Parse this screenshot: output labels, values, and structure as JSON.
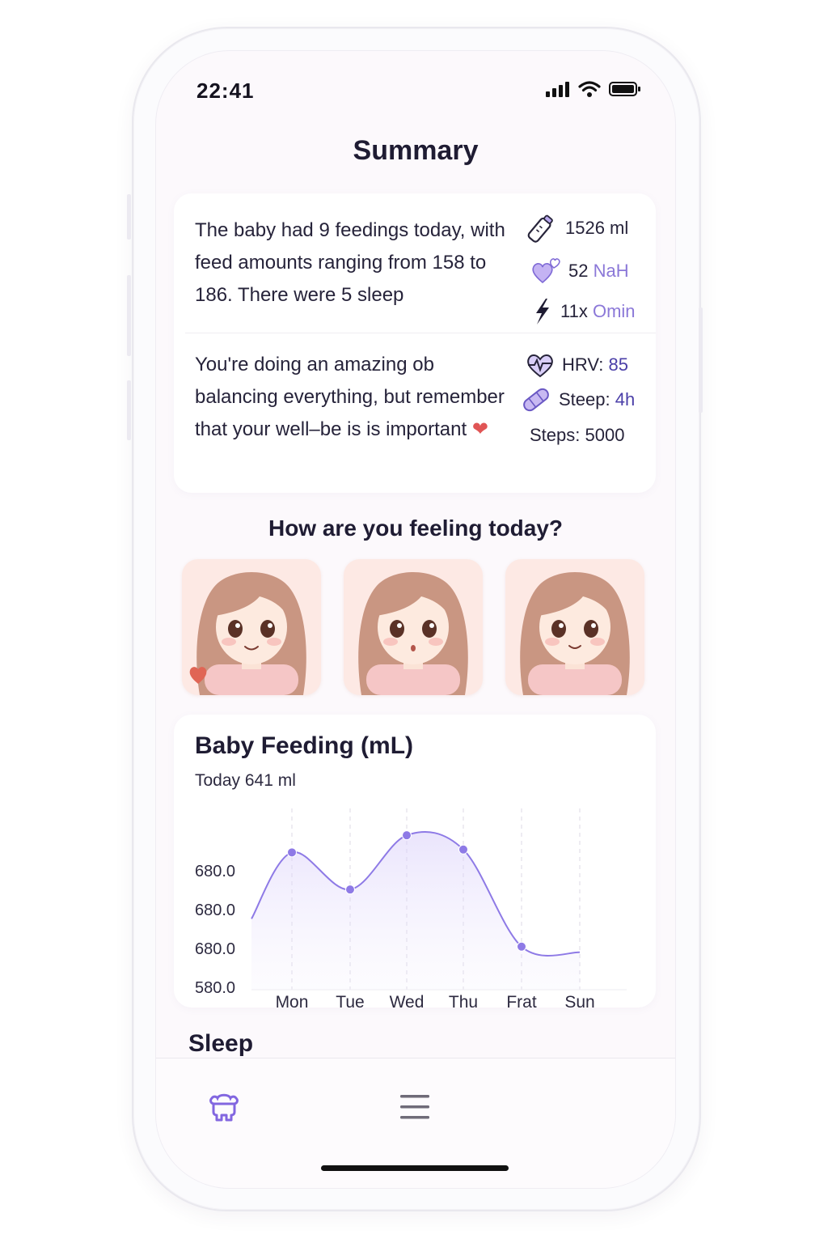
{
  "status_bar": {
    "time": "22:41"
  },
  "page": {
    "title": "Summary"
  },
  "summary": {
    "text": "The baby had 9 feedings today, with feed amounts ranging from 158 to 186. There were 5 sleep",
    "stats": [
      {
        "icon": "baby-bottle-icon",
        "value": "1526 ml",
        "accent": ""
      },
      {
        "icon": "hearts-icon",
        "value": "52 ",
        "accent": "NaH"
      },
      {
        "icon": "lightning-icon",
        "value": "11x ",
        "accent": "Omin"
      }
    ]
  },
  "wellbeing": {
    "text": "You're doing an amazing ob balancing everything, but remember that your well–be is is important",
    "heart": "❤",
    "stats": [
      {
        "icon": "heart-rate-icon",
        "label": "HRV: ",
        "value": "85"
      },
      {
        "icon": "bandage-icon",
        "label": "Steep: ",
        "value": "4h"
      },
      {
        "icon": "",
        "label": "Steps: 5000",
        "value": ""
      }
    ]
  },
  "mood": {
    "question": "How are you feeling today?",
    "options": [
      {
        "name": "mood-happy",
        "expression": "smile"
      },
      {
        "name": "mood-neutral",
        "expression": "neutral"
      },
      {
        "name": "mood-content",
        "expression": "smile"
      }
    ]
  },
  "feeding_chart": {
    "title": "Baby Feeding (mL)",
    "subtitle": "Today 641 ml"
  },
  "chart_data": {
    "type": "area",
    "title": "Baby Feeding (mL)",
    "categories": [
      "Mon",
      "Tue",
      "Wed",
      "Thu",
      "Frat",
      "Sun"
    ],
    "ytick_labels": [
      "680.0",
      "680.0",
      "680.0",
      "580.0"
    ],
    "series": [
      {
        "values": [
          676,
          650,
          688,
          678,
          610,
          606
        ],
        "markers": [
          true,
          true,
          true,
          true,
          true,
          false
        ]
      }
    ],
    "ylim": [
      590,
      700
    ],
    "grid": "vertical dashed",
    "color": "#8e7ae6"
  },
  "sleep": {
    "label": "Sleep"
  },
  "tabbar": {
    "items": [
      {
        "name": "tab-home",
        "icon": "baby-icon",
        "active": true
      },
      {
        "name": "tab-menu",
        "icon": "menu-icon",
        "active": false
      }
    ]
  },
  "colors": {
    "accent": "#8e7ae6",
    "accent_dark": "#4b3fa8",
    "background": "#fcf9fc",
    "card": "#ffffff"
  }
}
